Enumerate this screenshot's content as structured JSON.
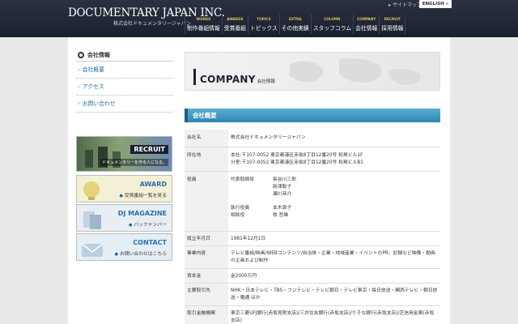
{
  "header": {
    "logo_main": "DOCUMENTARY JAPAN INC.",
    "logo_sub": "株式会社ドキュメンタリージャパン",
    "sitemap": "サイトマップ",
    "english": "ENGLISH",
    "nav": [
      {
        "en": "WORKS",
        "jp": "制作番組情報"
      },
      {
        "en": "AWARDS",
        "jp": "受賞番組"
      },
      {
        "en": "TOPICS",
        "jp": "トピックス"
      },
      {
        "en": "EXTRA",
        "jp": "その他実績"
      },
      {
        "en": "COLUMN",
        "jp": "スタッフコラム"
      },
      {
        "en": "COMPANY",
        "jp": "会社情報"
      },
      {
        "en": "RECRUIT",
        "jp": "採用情報"
      }
    ]
  },
  "sidebar": {
    "title": "会社情報",
    "links": [
      "会社概要",
      "アクセス",
      "お問い合わせ"
    ]
  },
  "banners": {
    "recruit": {
      "title": "RECRUIT",
      "sub": "ドキュメンタリーを作る人になる。"
    },
    "award": {
      "title": "AWARD",
      "sub": "受賞番組一覧を見る"
    },
    "djmag": {
      "title": "DJ MAGAZINE",
      "sub": "バックナンバー"
    },
    "contact": {
      "title": "CONTACT",
      "sub": "お問い合わせはこちら"
    }
  },
  "hero": {
    "en": "COMPANY",
    "jp": "会社情報"
  },
  "section_title": "会社概要",
  "table": {
    "name_label": "会社名",
    "name_value": "株式会社ドキュメンタリージャパン",
    "address_label": "所在地",
    "address_1": "本社:〒107-0052 東京都港区赤坂8丁目12番20号 和晃ビル1F",
    "address_2": "分室:〒107-0052 東京都港区赤坂8丁目12番20号 和晃ビルB1",
    "officers_label": "役員",
    "rep_role": "代表取締役",
    "rep_names": [
      "長谷川三郎",
      "新津聡子",
      "瀬川恭介"
    ],
    "exec_role": "執行役員",
    "exec_name": "本木敦子",
    "advisor_role": "相談役",
    "advisor_name": "牧 哲雄",
    "founded_label": "設立年月日",
    "founded_value": "1981年12月1日",
    "business_label": "事業内容",
    "business_value": "テレビ番組/映画/WEBコンテンツ/自治体・企業・地域産業・イベントのPR、記録など映像・動画の企画および制作",
    "capital_label": "資本金",
    "capital_value": "金2000万円",
    "clients_label": "主要取引先",
    "clients_value": "NHK・日本テレビ・TBS・フジテレビ・テレビ朝日・テレビ東京・毎日放送・関西テレビ・朝日放送・電通 ほか",
    "banks_label": "取引金融機関",
    "banks_value": "東京三菱UFJ銀行(赤坂見附支店)/三井住友銀行(赤坂支店)/りそな銀行(赤坂支店)/芝信用金庫(赤坂支店)"
  }
}
